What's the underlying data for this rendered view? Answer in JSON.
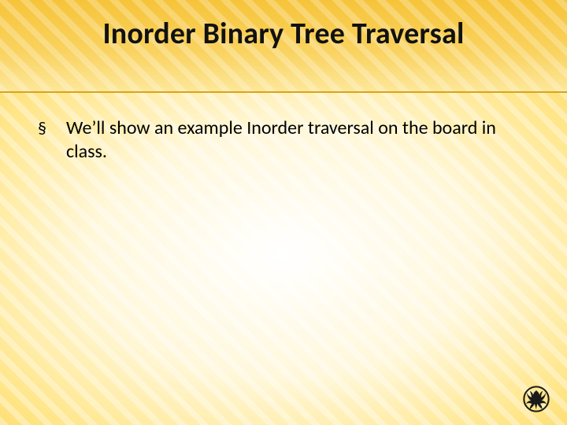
{
  "slide": {
    "title": "Inorder Binary Tree Traversal",
    "bullets": [
      {
        "marker": "§",
        "text": "We’ll show an example Inorder traversal on the board in class."
      }
    ]
  },
  "logo": {
    "name": "ucf-pegasus-logo"
  }
}
